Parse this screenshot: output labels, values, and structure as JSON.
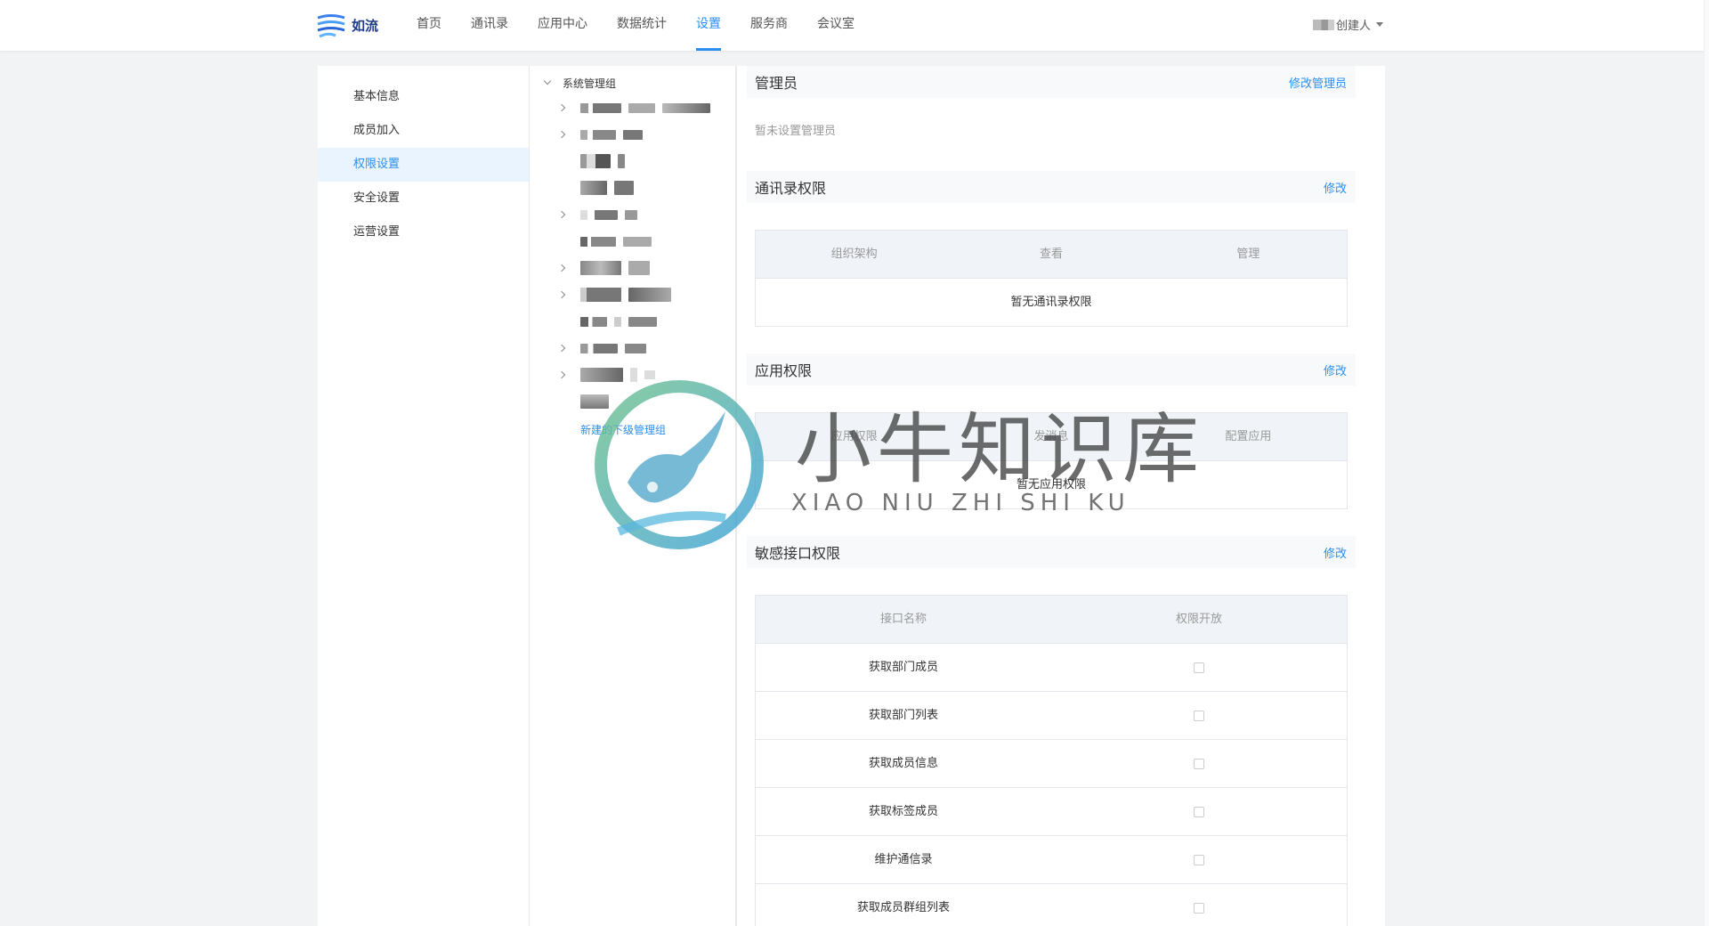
{
  "app": {
    "logo_text": "如流"
  },
  "nav": {
    "items": [
      "首页",
      "通讯录",
      "应用中心",
      "数据统计",
      "设置",
      "服务商",
      "会议室"
    ],
    "active": "设置"
  },
  "user": {
    "role": "创建人"
  },
  "sidebar": {
    "items": [
      "基本信息",
      "成员加入",
      "权限设置",
      "安全设置",
      "运营设置"
    ],
    "active": "权限设置"
  },
  "tree": {
    "root": "系统管理组",
    "new_sub_group": "新建的下级管理组"
  },
  "sections": {
    "admin": {
      "title": "管理员",
      "action": "修改管理员",
      "empty": "暂未设置管理员"
    },
    "contacts": {
      "title": "通讯录权限",
      "action": "修改",
      "columns": [
        "组织架构",
        "查看",
        "管理"
      ],
      "empty": "暂无通讯录权限"
    },
    "apps": {
      "title": "应用权限",
      "action": "修改",
      "columns": [
        "应用权限",
        "发消息",
        "配置应用"
      ],
      "empty": "暂无应用权限"
    },
    "sensitive": {
      "title": "敏感接口权限",
      "action": "修改",
      "columns": [
        "接口名称",
        "权限开放"
      ],
      "rows": [
        "获取部门成员",
        "获取部门列表",
        "获取成员信息",
        "获取标签成员",
        "维护通信录",
        "获取成员群组列表"
      ]
    }
  },
  "watermark": {
    "title": "小牛知识库",
    "subtitle": "XIAO NIU ZHI SHI KU"
  },
  "colors": {
    "accent": "#2b8ef0",
    "logo": "#1e3b8c"
  }
}
